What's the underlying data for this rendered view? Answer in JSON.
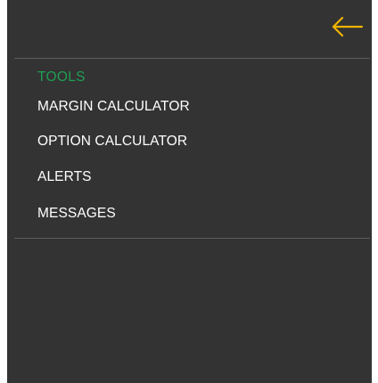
{
  "menu": {
    "back_icon": "arrow-left-icon",
    "accent_color": "#f0b400",
    "section": {
      "title": "TOOLS",
      "title_color": "#1f9e53",
      "items": [
        {
          "label": "MARGIN CALCULATOR"
        },
        {
          "label": "OPTION CALCULATOR"
        },
        {
          "label": "ALERTS"
        },
        {
          "label": "MESSAGES"
        }
      ]
    }
  }
}
